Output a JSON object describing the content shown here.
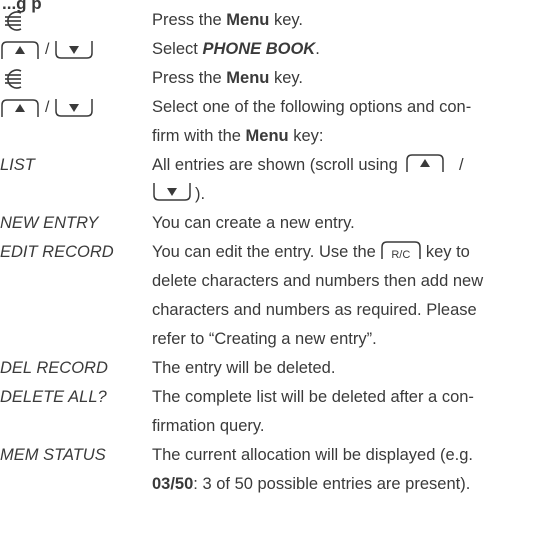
{
  "heading_fragment": "...g  p",
  "rows": {
    "r1": {
      "text_a": "Press the ",
      "bold_a": "Menu",
      "text_b": " key."
    },
    "r2": {
      "text_a": "Select ",
      "bold_italic": "PHONE BOOK",
      "text_b": "."
    },
    "r3": {
      "text_a": "Press the ",
      "bold_a": "Menu",
      "text_b": " key."
    },
    "r4": {
      "line1": "Select one of the following options and con-",
      "line2_a": "firm with the ",
      "bold_a": "Menu",
      "line2_b": " key:"
    },
    "list": {
      "label": "LIST",
      "text_a": "All entries are shown (scroll using",
      "sep": "/",
      "text_b": ")."
    },
    "new_entry": {
      "label": "NEW ENTRY",
      "text": "You can create a new entry."
    },
    "edit_record": {
      "label": "EDIT RECORD",
      "text_a": "You can edit the entry. Use the",
      "key_label": "R/C",
      "text_b": "key to",
      "line2": "delete characters and numbers then add new",
      "line3": "characters and numbers as required. Please",
      "line4": "refer to “Creating a new entry”."
    },
    "del_record": {
      "label": "DEL RECORD",
      "text": "The entry will be deleted."
    },
    "delete_all": {
      "label": "DELETE ALL?",
      "line1": "The complete list will be deleted after a con-",
      "line2": "firmation query."
    },
    "mem_status": {
      "label": "MEM STATUS",
      "line1": "The current allocation will be displayed (e.g.",
      "bold": "03/50",
      "line2": ": 3 of 50 possible entries are present)."
    }
  },
  "key_separator": "/",
  "icons": {
    "menu": "menu-key-icon",
    "up": "up-arrow-key-icon",
    "down": "down-arrow-key-icon",
    "rc": "rc-key-icon"
  }
}
